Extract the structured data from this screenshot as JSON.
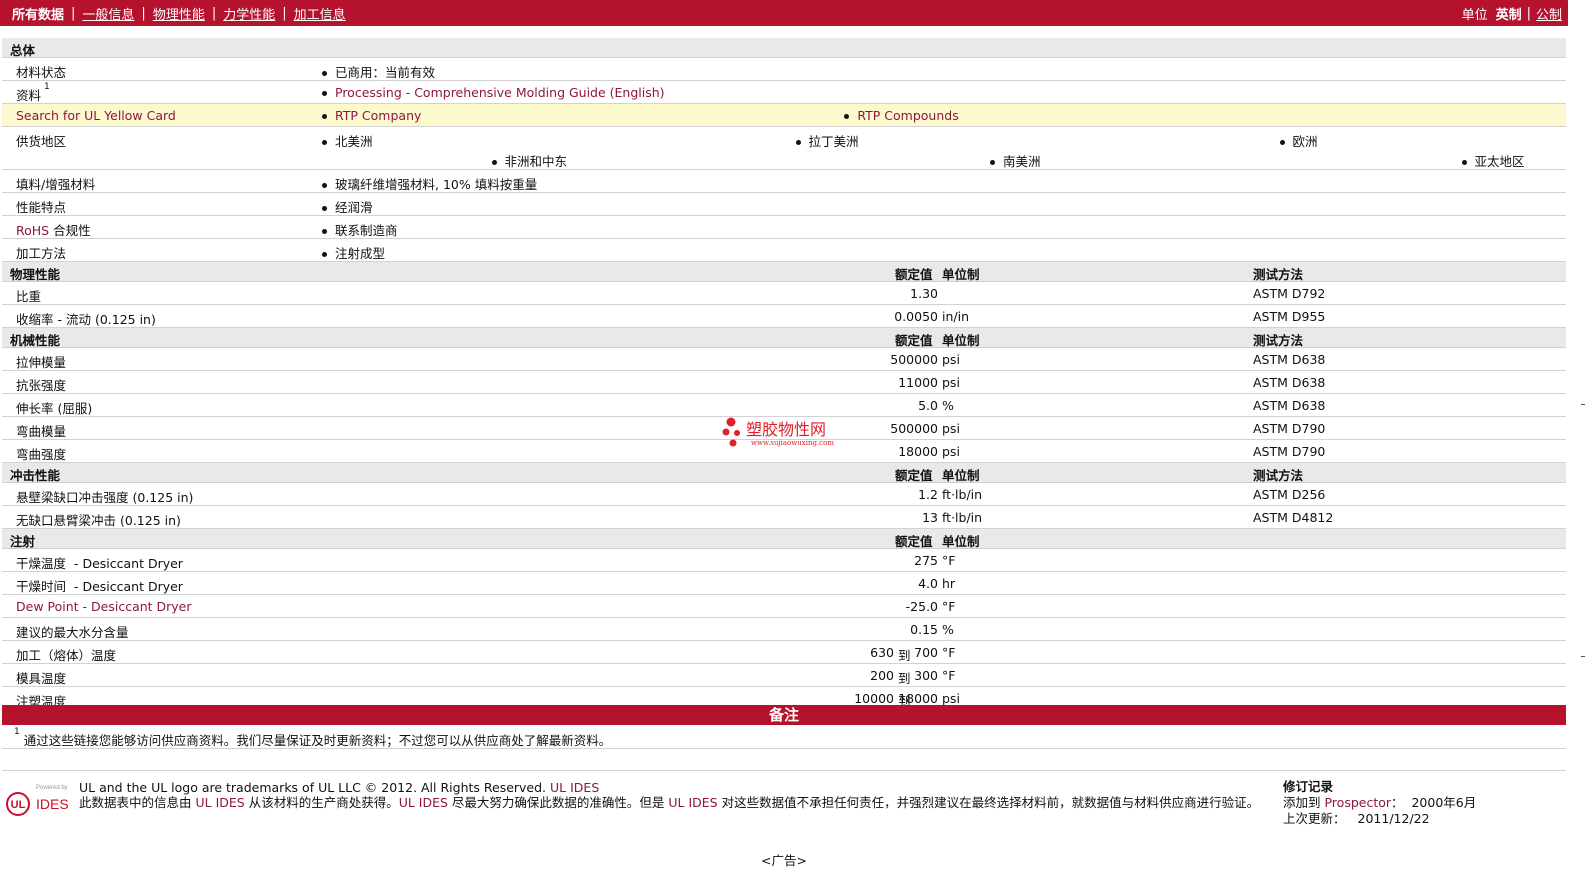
{
  "nav": {
    "items": [
      "所有数据",
      "一般信息",
      "物理性能",
      "力学性能",
      "加工信息"
    ],
    "unit_label": "单位",
    "unit_english": "英制",
    "unit_metric": "公制"
  },
  "general": {
    "heading": "总体",
    "material_status": {
      "label": "材料状态",
      "value": "已商用：当前有效"
    },
    "documents": {
      "label": "资料",
      "sup": "1",
      "link": "Processing - Comprehensive Molding Guide (English)"
    },
    "yellow_card": {
      "label": "Search for UL Yellow Card",
      "link1": "RTP Company",
      "link2": "RTP Compounds"
    },
    "availability": {
      "label": "供货地区",
      "regions": [
        "北美洲",
        "拉丁美洲",
        "欧洲",
        "非洲和中东",
        "南美洲",
        "亚太地区"
      ]
    },
    "filler": {
      "label": "填料/增强材料",
      "value": "玻璃纤维增强材料, 10% 填料按重量"
    },
    "features": {
      "label": "性能特点",
      "value": "经润滑"
    },
    "rohs": {
      "label_link": "RoHS",
      "label_rest": " 合规性",
      "value": "联系制造商"
    },
    "processing": {
      "label": "加工方法",
      "value": "注射成型"
    }
  },
  "columns": {
    "nominal": "额定值",
    "unit": "单位制",
    "method": "测试方法"
  },
  "physical": {
    "heading": "物理性能",
    "rows": [
      {
        "label": "比重",
        "extra": "",
        "value": "1.30",
        "unit": "",
        "method": "ASTM D792"
      },
      {
        "label": "收缩率  - 流动",
        "extra": "(0.125 in)",
        "value": "0.0050",
        "unit": "in/in",
        "method": "ASTM D955"
      }
    ]
  },
  "mechanical": {
    "heading": "机械性能",
    "rows": [
      {
        "label": "拉伸模量",
        "extra": "",
        "value": "500000",
        "unit": "psi",
        "method": "ASTM D638"
      },
      {
        "label": "抗张强度",
        "extra": "",
        "value": "11000",
        "unit": "psi",
        "method": "ASTM D638"
      },
      {
        "label": "伸长率 (屈服)",
        "extra": "",
        "value": "5.0",
        "unit": "%",
        "method": "ASTM D638"
      },
      {
        "label": "弯曲模量",
        "extra": "",
        "value": "500000",
        "unit": "psi",
        "method": "ASTM D790"
      },
      {
        "label": "弯曲强度",
        "extra": "",
        "value": "18000",
        "unit": "psi",
        "method": "ASTM D790"
      }
    ]
  },
  "impact": {
    "heading": "冲击性能",
    "rows": [
      {
        "label": "悬壁梁缺口冲击强度",
        "extra": "(0.125 in)",
        "value": "1.2",
        "unit": "ft·lb/in",
        "method": "ASTM D256"
      },
      {
        "label": "无缺口悬臂梁冲击",
        "extra": "(0.125 in)",
        "value": "13",
        "unit": "ft·lb/in",
        "method": "ASTM D4812"
      }
    ]
  },
  "injection": {
    "heading": "注射",
    "rows": [
      {
        "label": "干燥温度",
        "sub": "  - Desiccant Dryer",
        "value": "275",
        "unit": "°F"
      },
      {
        "label": "干燥时间",
        "sub": "  - Desiccant Dryer",
        "value": "4.0",
        "unit": "hr"
      },
      {
        "label_link": "Dew Point",
        "sub": " - Desiccant Dryer",
        "value": "-25.0",
        "unit": "°F"
      },
      {
        "label": "建议的最大水分含量",
        "sub": "",
        "value": "0.15",
        "unit": "%"
      }
    ],
    "ranges": [
      {
        "label": "加工（熔体）温度",
        "low": "630",
        "to": "到",
        "high": "700",
        "unit": "°F"
      },
      {
        "label": "模具温度",
        "low": "200",
        "to": "到",
        "high": "300",
        "unit": "°F"
      },
      {
        "label": "注塑温度",
        "low": "10000",
        "to": "到",
        "high": "18000",
        "unit": "psi"
      }
    ]
  },
  "notes": {
    "heading": "备注",
    "sup": "1",
    "text": "通过这些链接您能够访问供应商资料。我们尽量保证及时更新资料；不过您可以从供应商处了解最新资料。"
  },
  "footer": {
    "logo_small": "Powered by",
    "logo_ul": "UL",
    "logo_ides": "IDES",
    "line1": "UL and the UL logo are trademarks of UL LLC © 2012. All Rights Reserved.",
    "line1_link": "UL IDES",
    "line2_a": "此数据表中的信息由 ",
    "line2_link1": "UL IDES",
    "line2_b": " 从该材料的生产商处获得。",
    "line2_link2": "UL IDES",
    "line2_c": " 尽最大努力确保此数据的准确性。但是 ",
    "line2_link3": "UL IDES",
    "line2_d": " 对这些数据值不承担任何责任，并强烈建议在最终选择材料前，就数据值与材料供应商进行验证。",
    "revision_title": "修订记录",
    "added_label": "添加到 ",
    "added_link": "Prospector",
    "added_value": "：  2000年6月",
    "updated_label": "上次更新：",
    "updated_value": "2011/12/22",
    "ad": "<广告>"
  },
  "watermark": {
    "title": "塑胶物性网",
    "url": "www.sujiaowuxing.com",
    "color": "#e0202a"
  },
  "colors": {
    "brand": "#b5122d",
    "link": "#8b1840",
    "highlight": "#fdf9cf"
  }
}
